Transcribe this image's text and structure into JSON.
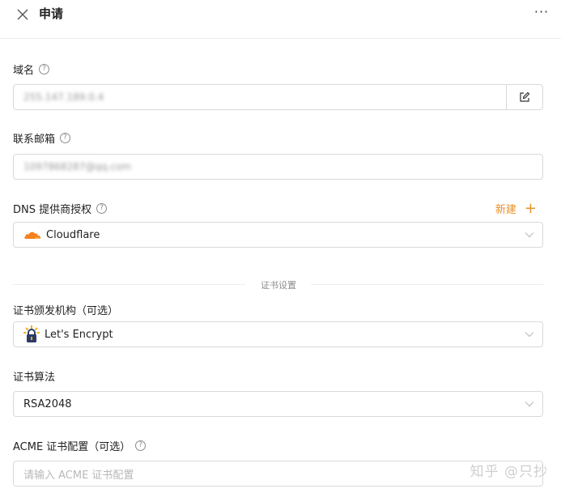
{
  "header": {
    "title": "申请",
    "close_icon": "close-icon",
    "more_label": "···"
  },
  "domain_field": {
    "label": "域名",
    "value": "255.147.189.0.4",
    "addon_icon": "edit-icon"
  },
  "email_field": {
    "label": "联系邮箱",
    "value": "1097868287@qq.com"
  },
  "dns_field": {
    "label": "DNS 提供商授权",
    "new_label": "新建",
    "new_icon": "plus-icon",
    "value": "Cloudflare",
    "icon": "cloudflare-icon"
  },
  "divider": {
    "label": "证书设置"
  },
  "ca_field": {
    "label": "证书颁发机构（可选）",
    "value": "Let's Encrypt",
    "icon": "lets-encrypt-icon"
  },
  "algo_field": {
    "label": "证书算法",
    "value": "RSA2048"
  },
  "acme_field": {
    "label": "ACME 证书配置（可选）",
    "placeholder": "请输入 ACME 证书配置"
  },
  "watermark": "知乎 @只抄",
  "colors": {
    "accent": "#e8912a",
    "border": "#d9d9d9",
    "cloudflare": "#f48120",
    "lets_encrypt_blue": "#2c3c69",
    "lets_encrypt_yellow": "#f6a402"
  },
  "help_glyph": "?"
}
